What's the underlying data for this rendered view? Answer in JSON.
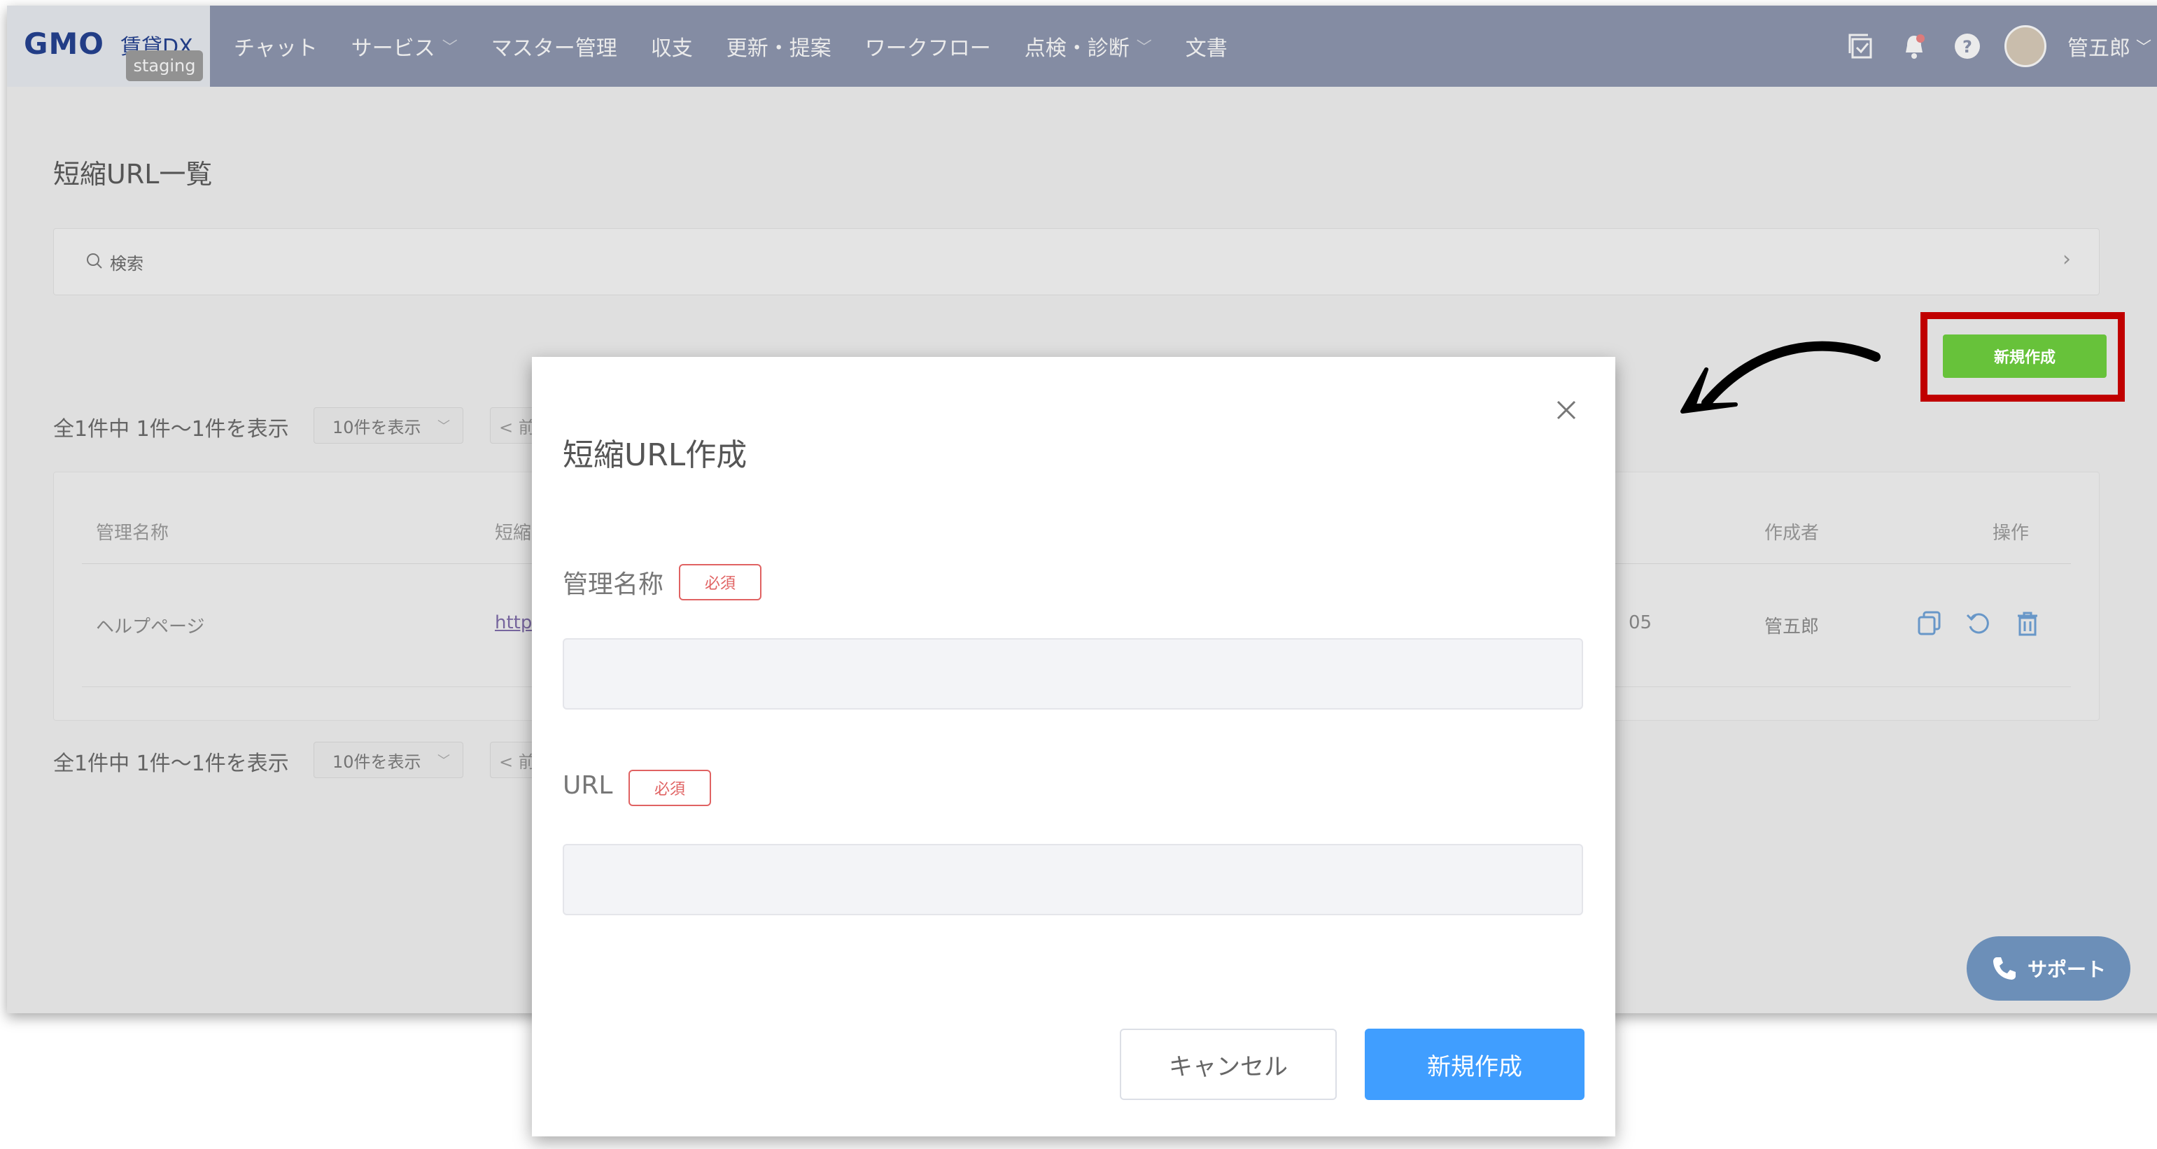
{
  "app": {
    "logo_text": "GMO",
    "logo_suffix": "賃貸DX",
    "env_badge": "staging"
  },
  "nav": {
    "items": [
      {
        "label": "チャット",
        "has_dropdown": false
      },
      {
        "label": "サービス",
        "has_dropdown": true
      },
      {
        "label": "マスター管理",
        "has_dropdown": false
      },
      {
        "label": "収支",
        "has_dropdown": false
      },
      {
        "label": "更新・提案",
        "has_dropdown": false
      },
      {
        "label": "ワークフロー",
        "has_dropdown": false
      },
      {
        "label": "点検・診断",
        "has_dropdown": true
      },
      {
        "label": "文書",
        "has_dropdown": false
      }
    ],
    "user_name": "管五郎",
    "icons": [
      "task-check-icon",
      "bell-icon",
      "help-icon"
    ]
  },
  "page": {
    "title": "短縮URL一覧",
    "search_label": "検索",
    "new_button": "新規作成"
  },
  "pagination": {
    "summary": "全1件中 1件～1件を表示",
    "per_page": "10件を表示",
    "prev": "< 前"
  },
  "table": {
    "headers": [
      "管理名称",
      "短縮URL",
      "作成者",
      "操作"
    ],
    "rows": [
      {
        "name": "ヘルプページ",
        "short_url": "https",
        "date_fragment": "05",
        "creator": "管五郎"
      }
    ]
  },
  "support_button": "サポート",
  "modal": {
    "title": "短縮URL作成",
    "fields": [
      {
        "label": "管理名称",
        "required_badge": "必須",
        "value": ""
      },
      {
        "label": "URL",
        "required_badge": "必須",
        "value": ""
      }
    ],
    "cancel_label": "キャンセル",
    "submit_label": "新規作成"
  },
  "colors": {
    "nav_bg": "#8a93ad",
    "new_button_bg": "#67c23a",
    "highlight_border": "#c00000",
    "primary": "#409eff",
    "required": "#e06262",
    "support_bg": "#6c8fb8"
  }
}
